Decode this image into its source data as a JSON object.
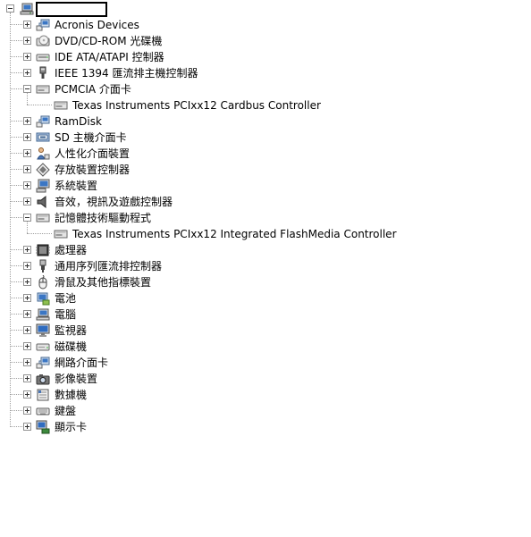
{
  "tree": {
    "root": {
      "name": "",
      "icon": "computer-icon",
      "expanded": true
    },
    "items": [
      {
        "label": "Acronis Devices",
        "icon": "network-device-icon",
        "expanded": false
      },
      {
        "label": "DVD/CD-ROM 光碟機",
        "icon": "optical-drive-icon",
        "expanded": false
      },
      {
        "label": "IDE ATA/ATAPI 控制器",
        "icon": "ide-controller-icon",
        "expanded": false
      },
      {
        "label": "IEEE 1394 匯流排主機控制器",
        "icon": "ieee1394-icon",
        "expanded": false
      },
      {
        "label": "PCMCIA 介面卡",
        "icon": "pcmcia-adapter-icon",
        "expanded": true,
        "children": [
          {
            "label": "Texas Instruments PCIxx12 Cardbus Controller",
            "icon": "pcmcia-device-icon"
          }
        ]
      },
      {
        "label": "RamDisk",
        "icon": "network-device-icon",
        "expanded": false
      },
      {
        "label": "SD 主機介面卡",
        "icon": "sd-host-icon",
        "expanded": false
      },
      {
        "label": "人性化介面裝置",
        "icon": "hid-icon",
        "expanded": false
      },
      {
        "label": "存放裝置控制器",
        "icon": "storage-controller-icon",
        "expanded": false
      },
      {
        "label": "系統裝置",
        "icon": "system-device-icon",
        "expanded": false
      },
      {
        "label": "音效，視訊及遊戲控制器",
        "icon": "speaker-icon",
        "expanded": false
      },
      {
        "label": "記憶體技術驅動程式",
        "icon": "memory-tech-icon",
        "expanded": true,
        "children": [
          {
            "label": "Texas Instruments PCIxx12 Integrated FlashMedia Controller",
            "icon": "memory-device-icon"
          }
        ]
      },
      {
        "label": "處理器",
        "icon": "processor-icon",
        "expanded": false
      },
      {
        "label": "通用序列匯流排控制器",
        "icon": "usb-icon",
        "expanded": false
      },
      {
        "label": "滑鼠及其他指標裝置",
        "icon": "mouse-icon",
        "expanded": false
      },
      {
        "label": "電池",
        "icon": "battery-icon",
        "expanded": false
      },
      {
        "label": "電腦",
        "icon": "computer-icon",
        "expanded": false
      },
      {
        "label": "監視器",
        "icon": "monitor-icon",
        "expanded": false
      },
      {
        "label": "磁碟機",
        "icon": "disk-drive-icon",
        "expanded": false
      },
      {
        "label": "網路介面卡",
        "icon": "network-adapter-icon",
        "expanded": false
      },
      {
        "label": "影像裝置",
        "icon": "imaging-device-icon",
        "expanded": false
      },
      {
        "label": "數據機",
        "icon": "modem-icon",
        "expanded": false
      },
      {
        "label": "鍵盤",
        "icon": "keyboard-icon",
        "expanded": false
      },
      {
        "label": "顯示卡",
        "icon": "display-adapter-icon",
        "expanded": false
      }
    ]
  }
}
